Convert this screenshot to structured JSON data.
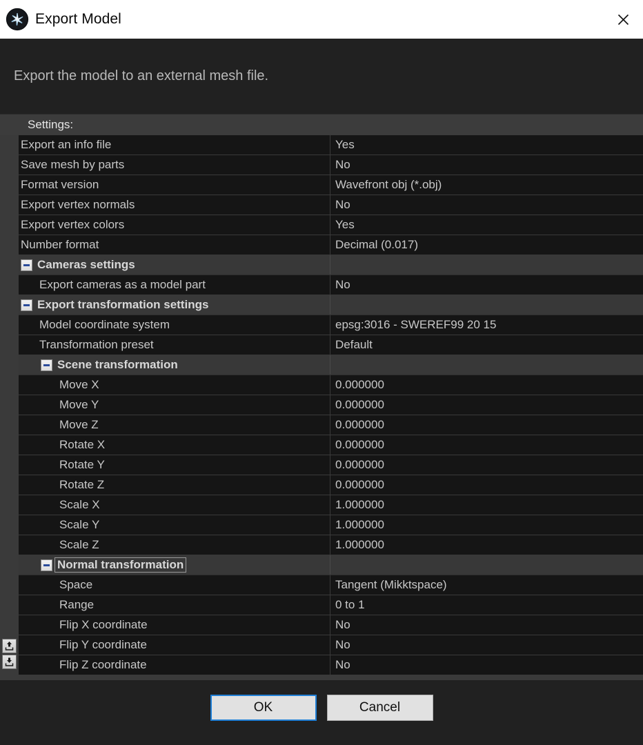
{
  "window": {
    "title": "Export Model",
    "icon": "aperture-icon",
    "close_label": "✕"
  },
  "description": {
    "text": "Export the model to an external mesh file."
  },
  "settings_header": {
    "label": "Settings:"
  },
  "gutter_buttons": [
    {
      "name": "load-preset-button",
      "icon": "upload-tray-icon"
    },
    {
      "name": "save-preset-button",
      "icon": "download-tray-icon"
    }
  ],
  "table": {
    "rows": [
      {
        "type": "item",
        "level": 0,
        "label": "Export an info file",
        "value": "Yes"
      },
      {
        "type": "item",
        "level": 0,
        "label": "Save mesh by parts",
        "value": "No"
      },
      {
        "type": "item",
        "level": 0,
        "label": "Format version",
        "value": "Wavefront obj (*.obj)"
      },
      {
        "type": "item",
        "level": 0,
        "label": "Export vertex normals",
        "value": "No"
      },
      {
        "type": "item",
        "level": 0,
        "label": "Export vertex colors",
        "value": "Yes"
      },
      {
        "type": "item",
        "level": 0,
        "label": "Number format",
        "value": "Decimal (0.017)"
      },
      {
        "type": "group",
        "level": 1,
        "label": "Cameras settings",
        "value": "",
        "expanded": true,
        "selected": false
      },
      {
        "type": "item",
        "level": 1,
        "label": "Export cameras as a model part",
        "value": "No"
      },
      {
        "type": "group",
        "level": 1,
        "label": "Export transformation settings",
        "value": "",
        "expanded": true,
        "selected": false
      },
      {
        "type": "item",
        "level": 1,
        "label": "Model coordinate system",
        "value": "epsg:3016 - SWEREF99 20 15"
      },
      {
        "type": "item",
        "level": 1,
        "label": "Transformation preset",
        "value": "Default"
      },
      {
        "type": "group",
        "level": 2,
        "label": "Scene transformation",
        "value": "",
        "expanded": true,
        "selected": false
      },
      {
        "type": "item",
        "level": 2,
        "label": "Move X",
        "value": "0.000000"
      },
      {
        "type": "item",
        "level": 2,
        "label": "Move Y",
        "value": "0.000000"
      },
      {
        "type": "item",
        "level": 2,
        "label": "Move Z",
        "value": "0.000000"
      },
      {
        "type": "item",
        "level": 2,
        "label": "Rotate X",
        "value": "0.000000"
      },
      {
        "type": "item",
        "level": 2,
        "label": "Rotate Y",
        "value": "0.000000"
      },
      {
        "type": "item",
        "level": 2,
        "label": "Rotate Z",
        "value": "0.000000"
      },
      {
        "type": "item",
        "level": 2,
        "label": "Scale X",
        "value": "1.000000"
      },
      {
        "type": "item",
        "level": 2,
        "label": "Scale Y",
        "value": "1.000000"
      },
      {
        "type": "item",
        "level": 2,
        "label": "Scale Z",
        "value": "1.000000"
      },
      {
        "type": "group",
        "level": 2,
        "label": "Normal transformation",
        "value": "",
        "expanded": true,
        "selected": true
      },
      {
        "type": "item",
        "level": 2,
        "label": "Space",
        "value": "Tangent (Mikktspace)"
      },
      {
        "type": "item",
        "level": 2,
        "label": "Range",
        "value": "0 to 1"
      },
      {
        "type": "item",
        "level": 2,
        "label": "Flip X coordinate",
        "value": "No"
      },
      {
        "type": "item",
        "level": 2,
        "label": "Flip Y coordinate",
        "value": "No"
      },
      {
        "type": "item",
        "level": 2,
        "label": "Flip Z coordinate",
        "value": "No"
      }
    ]
  },
  "footer": {
    "ok_label": "OK",
    "cancel_label": "Cancel"
  },
  "colors": {
    "titlebar_bg": "#ffffff",
    "dialog_bg": "#212121",
    "row_bg": "#151515",
    "group_bg": "#383838",
    "band_bg": "#3c3c3c",
    "text": "#c8c8c8",
    "accent_blue": "#1f7fd6",
    "expander_blue": "#2b4c9b"
  }
}
